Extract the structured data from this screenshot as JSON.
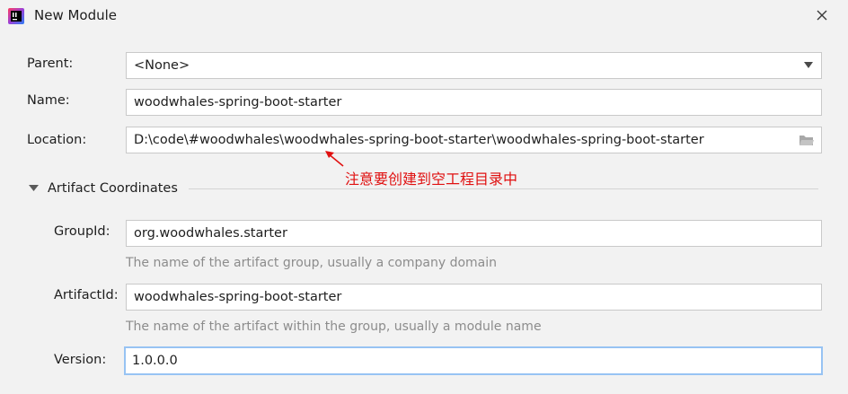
{
  "window": {
    "title": "New Module"
  },
  "form": {
    "parent": {
      "label": "Parent:",
      "value": "<None>"
    },
    "name": {
      "label": "Name:",
      "value": "woodwhales-spring-boot-starter"
    },
    "location": {
      "label": "Location:",
      "value": "D:\\code\\#woodwhales\\woodwhales-spring-boot-starter\\woodwhales-spring-boot-starter"
    }
  },
  "annotation": {
    "text": "注意要创建到空工程目录中",
    "color": "#e01010"
  },
  "artifact": {
    "section_title": "Artifact Coordinates",
    "group_id": {
      "label": "GroupId:",
      "value": "org.woodwhales.starter",
      "hint": "The name of the artifact group, usually a company domain"
    },
    "artifact_id": {
      "label": "ArtifactId:",
      "value": "woodwhales-spring-boot-starter",
      "hint": "The name of the artifact within the group, usually a module name"
    },
    "version": {
      "label": "Version:",
      "value": "1.0.0.0"
    }
  },
  "icons": {
    "app": "intellij-idea-icon",
    "close": "close-icon",
    "dropdown": "chevron-down-icon",
    "folder": "folder-icon",
    "section": "triangle-down-icon"
  },
  "colors": {
    "background": "#f2f2f2",
    "focus_border": "#97c3f3",
    "annotation": "#e01010",
    "hint": "#8c8c8c"
  }
}
